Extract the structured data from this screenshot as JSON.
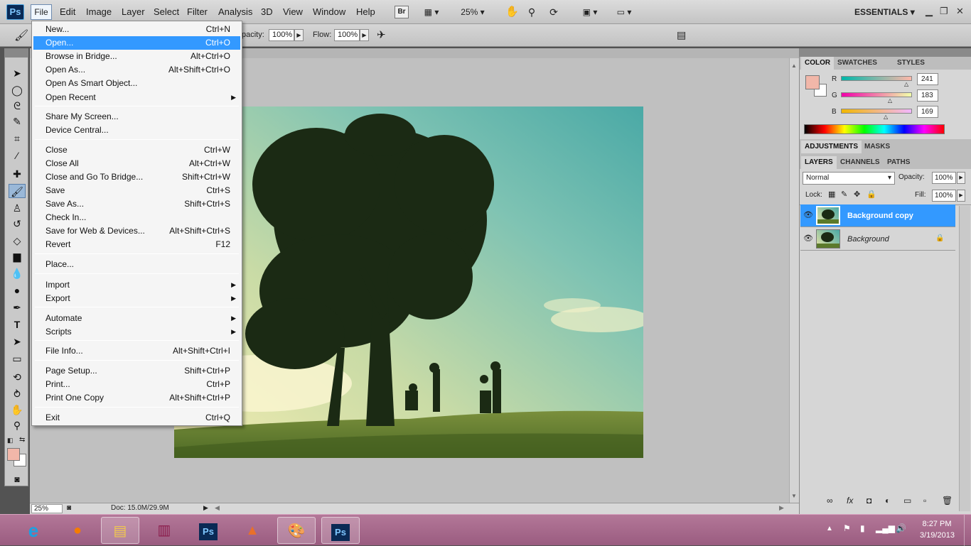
{
  "menubar": {
    "logo": "Ps",
    "items": [
      "File",
      "Edit",
      "Image",
      "Layer",
      "Select",
      "Filter",
      "Analysis",
      "3D",
      "View",
      "Window",
      "Help"
    ],
    "bridge_btn": "Br",
    "zoom": "25%",
    "workspace": "ESSENTIALS"
  },
  "options": {
    "opacity_label": "pacity:",
    "opacity_value": "100%",
    "flow_label": "Flow:",
    "flow_value": "100%"
  },
  "file_menu": {
    "items": [
      {
        "label": "New...",
        "shortcut": "Ctrl+N"
      },
      {
        "label": "Open...",
        "shortcut": "Ctrl+O"
      },
      {
        "label": "Browse in Bridge...",
        "shortcut": "Alt+Ctrl+O"
      },
      {
        "label": "Open As...",
        "shortcut": "Alt+Shift+Ctrl+O"
      },
      {
        "label": "Open As Smart Object...",
        "shortcut": ""
      },
      {
        "label": "Open Recent",
        "shortcut": ""
      },
      {
        "label": "Share My Screen...",
        "shortcut": ""
      },
      {
        "label": "Device Central...",
        "shortcut": ""
      },
      {
        "label": "Close",
        "shortcut": "Ctrl+W"
      },
      {
        "label": "Close All",
        "shortcut": "Alt+Ctrl+W"
      },
      {
        "label": "Close and Go To Bridge...",
        "shortcut": "Shift+Ctrl+W"
      },
      {
        "label": "Save",
        "shortcut": "Ctrl+S"
      },
      {
        "label": "Save As...",
        "shortcut": "Shift+Ctrl+S"
      },
      {
        "label": "Check In...",
        "shortcut": ""
      },
      {
        "label": "Save for Web & Devices...",
        "shortcut": "Alt+Shift+Ctrl+S"
      },
      {
        "label": "Revert",
        "shortcut": "F12"
      },
      {
        "label": "Place...",
        "shortcut": ""
      },
      {
        "label": "Import",
        "shortcut": ""
      },
      {
        "label": "Export",
        "shortcut": ""
      },
      {
        "label": "Automate",
        "shortcut": ""
      },
      {
        "label": "Scripts",
        "shortcut": ""
      },
      {
        "label": "File Info...",
        "shortcut": "Alt+Shift+Ctrl+I"
      },
      {
        "label": "Page Setup...",
        "shortcut": "Shift+Ctrl+P"
      },
      {
        "label": "Print...",
        "shortcut": "Ctrl+P"
      },
      {
        "label": "Print One Copy",
        "shortcut": "Alt+Shift+Ctrl+P"
      },
      {
        "label": "Exit",
        "shortcut": "Ctrl+Q"
      }
    ],
    "highlighted": "Open..."
  },
  "status": {
    "zoom": "25%",
    "doc": "Doc: 15.0M/29.9M"
  },
  "color_panel": {
    "tabs": [
      "COLOR",
      "SWATCHES",
      "STYLES"
    ],
    "r_label": "R",
    "r_value": "241",
    "g_label": "G",
    "g_value": "183",
    "b_label": "B",
    "b_value": "169",
    "foreground": "#f1b7a9"
  },
  "adjust_panel": {
    "tabs": [
      "ADJUSTMENTS",
      "MASKS"
    ]
  },
  "layers_panel": {
    "tabs": [
      "LAYERS",
      "CHANNELS",
      "PATHS"
    ],
    "blend_mode": "Normal",
    "opacity_label": "Opacity:",
    "opacity_value": "100%",
    "lock_label": "Lock:",
    "fill_label": "Fill:",
    "fill_value": "100%",
    "layers": [
      {
        "name": "Background copy",
        "selected": true
      },
      {
        "name": "Background",
        "selected": false
      }
    ]
  },
  "taskbar": {
    "time": "8:27 PM",
    "date": "3/19/2013",
    "apps": [
      "ie-icon",
      "firefox-icon",
      "explorer-icon",
      "winrar-icon",
      "photoshop-icon",
      "matlab-icon",
      "paint-icon",
      "photoshop-active-icon"
    ]
  },
  "colors": {
    "accent": "#3399ff",
    "taskbar": "#a8668a"
  }
}
